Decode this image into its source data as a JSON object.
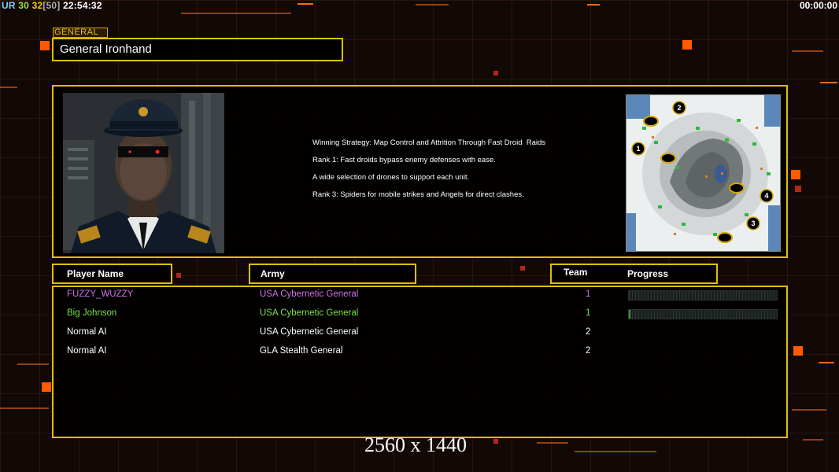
{
  "hud": {
    "ur": "UR",
    "v1": "30",
    "v2": "32",
    "v3": "[50]",
    "clock": "22:54:32",
    "timer": "00:00:00"
  },
  "general": {
    "section_label": "GENERAL",
    "name": "General Ironhand",
    "strategy_lines": [
      "Winning Strategy: Map Control and Attrition Through Fast Droid  Raids",
      "Rank 1: Fast droids bypass enemy defenses with ease.",
      "A wide selection of drones to support each unit.",
      "Rank 3: Spiders for mobile strikes and Angels for direct clashes."
    ]
  },
  "minimap": {
    "spawn_numbers": [
      "1",
      "2",
      "3",
      "4"
    ]
  },
  "table": {
    "headers": {
      "player": "Player Name",
      "army": "Army",
      "team": "Team",
      "progress": "Progress"
    },
    "rows": [
      {
        "name": "FUZZY_WUZZY",
        "army": "USA Cybernetic General",
        "team": "1",
        "color": "#d070e8",
        "progress": 0.0,
        "show_progress": true
      },
      {
        "name": "Big Johnson",
        "army": "USA Cybernetic General",
        "team": "1",
        "color": "#7de04a",
        "progress": 0.01,
        "show_progress": true
      },
      {
        "name": "Normal AI",
        "army": "USA Cybernetic General",
        "team": "2",
        "color": "#ffffff",
        "progress": 0,
        "show_progress": false
      },
      {
        "name": "Normal AI",
        "army": "GLA Stealth General",
        "team": "2",
        "color": "#ffffff",
        "progress": 0,
        "show_progress": false
      }
    ]
  },
  "resolution_label": "2560 x 1440"
}
